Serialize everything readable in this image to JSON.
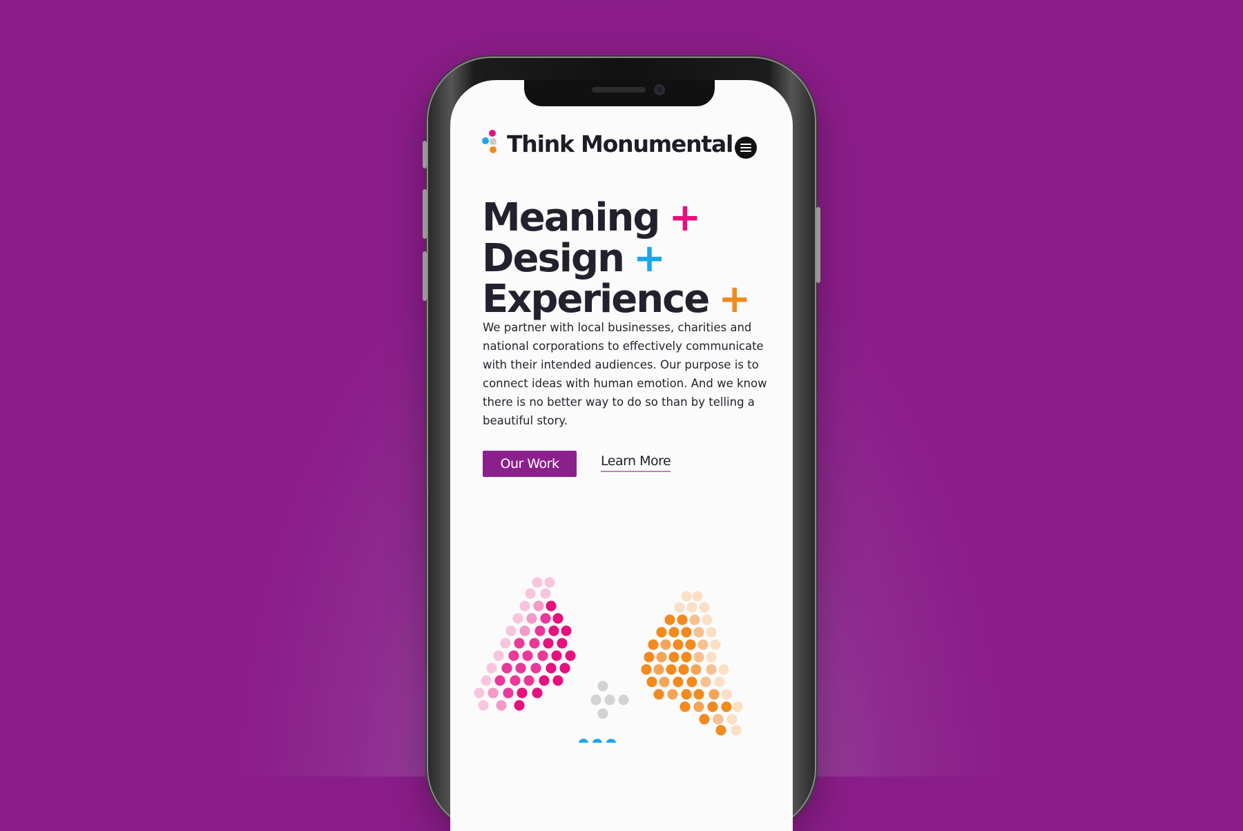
{
  "brand": {
    "name": "Think Monumental",
    "logo_icon": "dots-logo-icon",
    "logo_colors": [
      "#e4117f",
      "#1aa6e8",
      "#c9c9c9",
      "#f18a1f"
    ]
  },
  "nav": {
    "menu_icon": "hamburger-menu-icon"
  },
  "hero": {
    "lines": [
      {
        "text": "Meaning",
        "plus": "+",
        "plus_color": "#e4117f"
      },
      {
        "text": "Design",
        "plus": "+",
        "plus_color": "#1aa6e8"
      },
      {
        "text": "Experience",
        "plus": "+",
        "plus_color": "#f18a1f"
      }
    ],
    "intro": "We partner with local businesses, charities and national corporations to effectively communicate with their intended audiences. Our purpose is to connect ideas with human emotion. And we know there is no better way to do so than by telling a beautiful story."
  },
  "cta": {
    "primary_label": "Our Work",
    "secondary_label": "Learn More",
    "accent_color": "#8b1f8b"
  },
  "colors": {
    "page_background": "#8b1d89",
    "screen_background": "#fbfbfb",
    "text": "#22222e"
  }
}
